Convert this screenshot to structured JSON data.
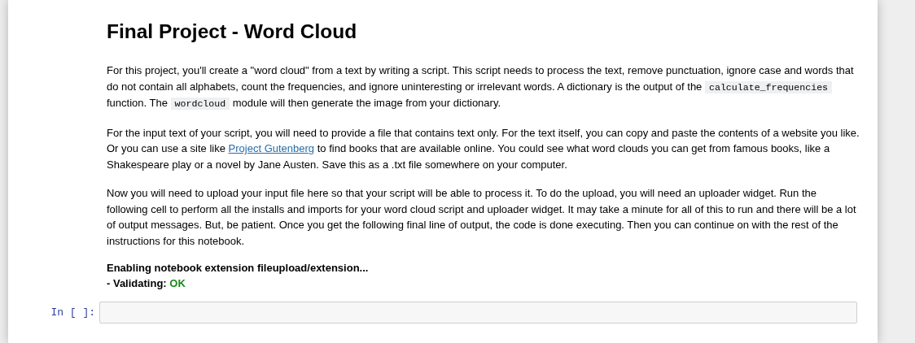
{
  "title": "Final Project - Word Cloud",
  "paragraphs": [
    {
      "segments": [
        {
          "kind": "text",
          "text": "For this project, you'll create a \"word cloud\" from a text by writing a script. This script needs to process the text, remove punctuation, ignore case and words that do not contain all alphabets, count the frequencies, and ignore uninteresting or irrelevant words. A dictionary is the output of the "
        },
        {
          "kind": "code",
          "text": "calculate_frequencies"
        },
        {
          "kind": "text",
          "text": " function. The "
        },
        {
          "kind": "code",
          "text": "wordcloud"
        },
        {
          "kind": "text",
          "text": " module will then generate the image from your dictionary."
        }
      ]
    },
    {
      "segments": [
        {
          "kind": "text",
          "text": "For the input text of your script, you will need to provide a file that contains text only. For the text itself, you can copy and paste the contents of a website you like. Or you can use a site like "
        },
        {
          "kind": "link",
          "text": "Project Gutenberg"
        },
        {
          "kind": "text",
          "text": " to find books that are available online. You could see what word clouds you can get from famous books, like a Shakespeare play or a novel by Jane Austen. Save this as a .txt file somewhere on your computer."
        }
      ]
    },
    {
      "segments": [
        {
          "kind": "text",
          "text": "Now you will need to upload your input file here so that your script will be able to process it. To do the upload, you will need an uploader widget. Run the following cell to perform all the installs and imports for your word cloud script and uploader widget. It may take a minute for all of this to run and there will be a lot of output messages. But, be patient. Once you get the following final line of output, the code is done executing. Then you can continue on with the rest of the instructions for this notebook."
        }
      ]
    }
  ],
  "output_lines": [
    {
      "text": "Enabling notebook extension fileupload/extension..."
    },
    {
      "text": "- Validating: ",
      "status": "OK"
    }
  ],
  "cell": {
    "prompt": "In [ ]:"
  }
}
